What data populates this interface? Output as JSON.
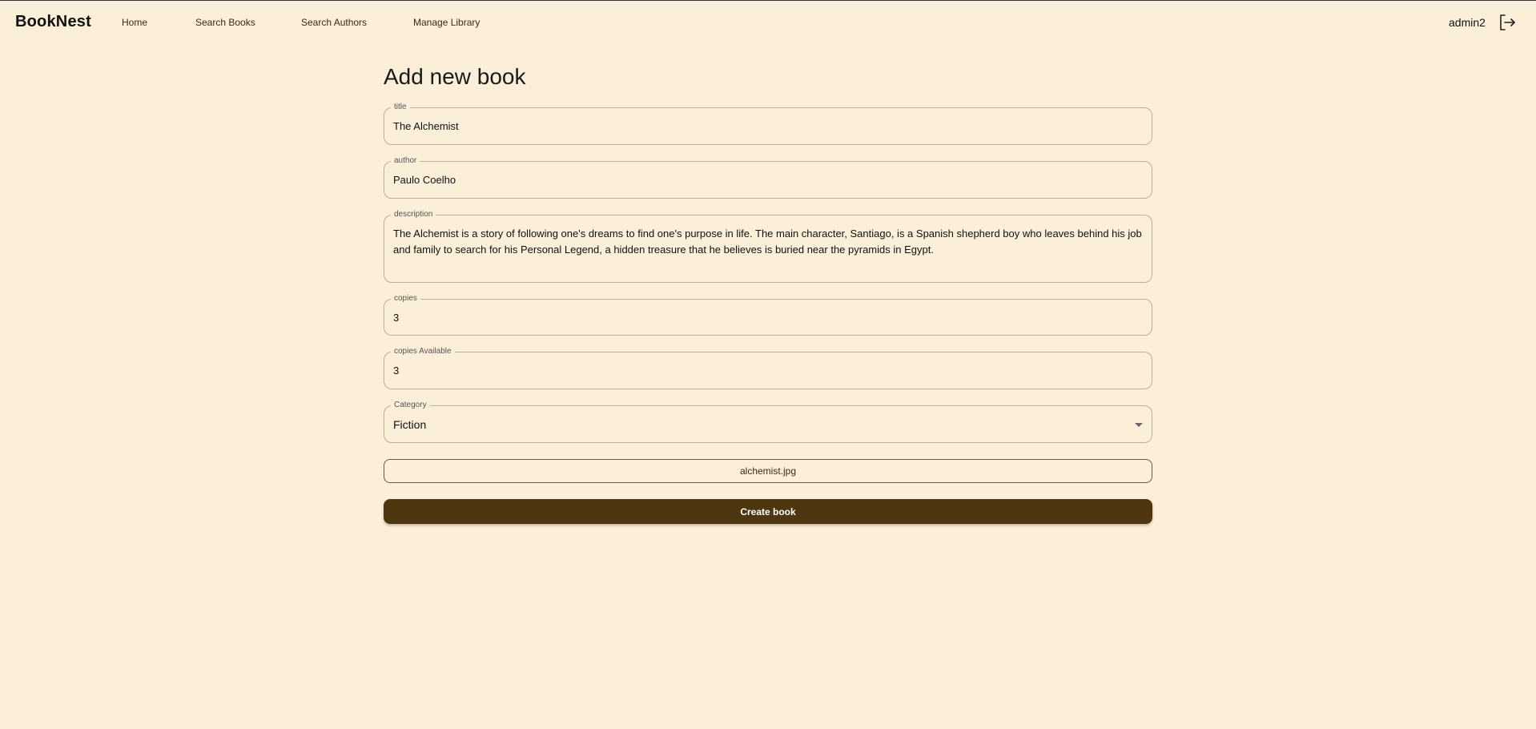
{
  "header": {
    "brand": "BookNest",
    "nav": [
      {
        "label": "Home"
      },
      {
        "label": "Search Books"
      },
      {
        "label": "Search Authors"
      },
      {
        "label": "Manage Library"
      }
    ],
    "username": "admin2",
    "logout_icon": "logout-icon"
  },
  "form": {
    "title": "Add new book",
    "fields": {
      "title": {
        "label": "title",
        "value": "The Alchemist"
      },
      "author": {
        "label": "author",
        "value": "Paulo Coelho"
      },
      "description": {
        "label": "description",
        "value": "The Alchemist is a story of following one's dreams to find one's purpose in life. The main character, Santiago, is a Spanish shepherd boy who leaves behind his job and family to search for his Personal Legend, a hidden treasure that he believes is buried near the pyramids in Egypt."
      },
      "copies": {
        "label": "copies",
        "value": "3"
      },
      "copies_available": {
        "label": "copies Available",
        "value": "3"
      },
      "category": {
        "label": "Category",
        "value": "Fiction"
      }
    },
    "file_button": "alchemist.jpg",
    "submit_button": "Create book"
  },
  "colors": {
    "background": "#fcefd9",
    "primary_button": "#4e3610",
    "field_border": "#b9b0a2"
  }
}
